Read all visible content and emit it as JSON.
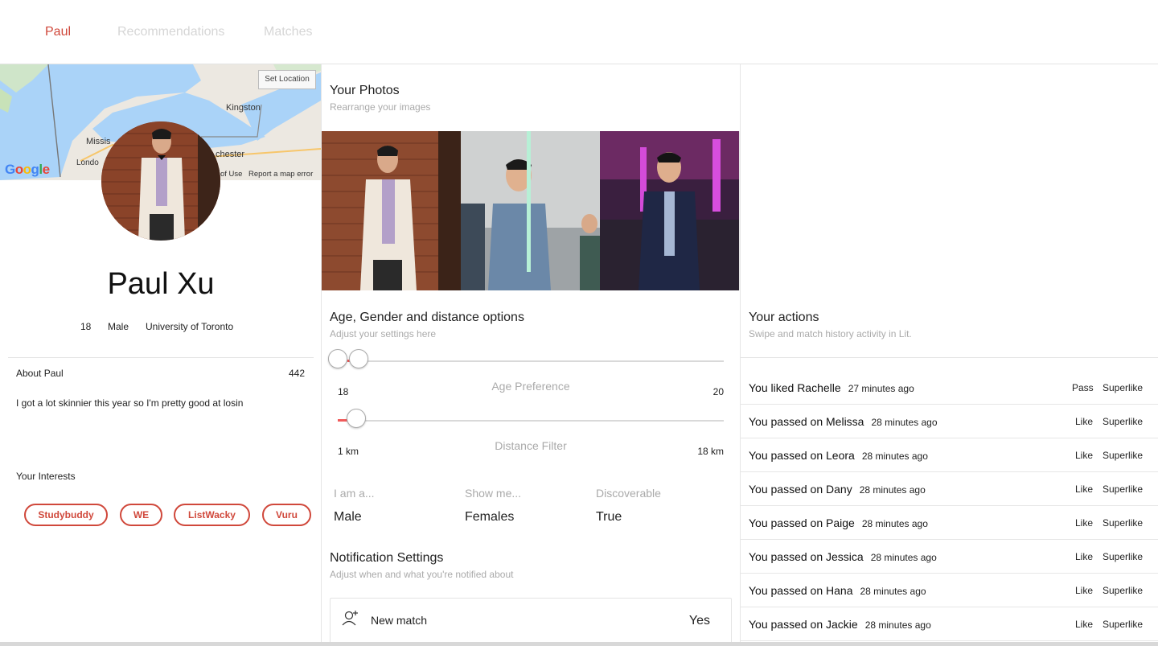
{
  "nav": {
    "tabs": [
      {
        "label": "Paul",
        "active": true
      },
      {
        "label": "Recommendations",
        "active": false
      },
      {
        "label": "Matches",
        "active": false
      }
    ]
  },
  "colors": {
    "accent": "#d0483b",
    "muted": "#aaaaaa",
    "slider": "#f05a5a"
  },
  "map": {
    "set_location_label": "Set Location",
    "labels": [
      "Kingston",
      "Missis",
      "chester",
      "Londo"
    ],
    "google_logo": "Google",
    "footer_terms": "of Use",
    "footer_report": "Report a map error"
  },
  "profile": {
    "name": "Paul Xu",
    "age": "18",
    "gender": "Male",
    "school": "University of Toronto",
    "about_title": "About Paul",
    "about_count": "442",
    "about_text": "I got a lot skinnier this year so I'm pretty good at losin",
    "interests_title": "Your Interests",
    "interests": [
      "Studybuddy",
      "WE",
      "ListWacky",
      "Vuru"
    ]
  },
  "photos": {
    "title": "Your Photos",
    "subtitle": "Rearrange your images"
  },
  "settings": {
    "title": "Age, Gender and distance options",
    "subtitle": "Adjust your settings here",
    "age_label": "Age Preference",
    "age_min": "18",
    "age_max": "20",
    "distance_label": "Distance Filter",
    "distance_min": "1 km",
    "distance_max": "18 km",
    "options": [
      {
        "label": "I am a...",
        "value": "Male"
      },
      {
        "label": "Show me...",
        "value": "Females"
      },
      {
        "label": "Discoverable",
        "value": "True"
      }
    ]
  },
  "notifications": {
    "title": "Notification Settings",
    "subtitle": "Adjust when and what you're notified about",
    "items": [
      {
        "label": "New match",
        "value": "Yes"
      }
    ]
  },
  "actions": {
    "title": "Your actions",
    "subtitle": "Swipe and match history activity in Lit.",
    "rows": [
      {
        "text": "You liked Rachelle",
        "time": "27 minutes ago",
        "btn1": "Pass",
        "btn2": "Superlike"
      },
      {
        "text": "You passed on Melissa",
        "time": "28 minutes ago",
        "btn1": "Like",
        "btn2": "Superlike"
      },
      {
        "text": "You passed on Leora",
        "time": "28 minutes ago",
        "btn1": "Like",
        "btn2": "Superlike"
      },
      {
        "text": "You passed on Dany",
        "time": "28 minutes ago",
        "btn1": "Like",
        "btn2": "Superlike"
      },
      {
        "text": "You passed on Paige",
        "time": "28 minutes ago",
        "btn1": "Like",
        "btn2": "Superlike"
      },
      {
        "text": "You passed on Jessica",
        "time": "28 minutes ago",
        "btn1": "Like",
        "btn2": "Superlike"
      },
      {
        "text": "You passed on Hana",
        "time": "28 minutes ago",
        "btn1": "Like",
        "btn2": "Superlike"
      },
      {
        "text": "You passed on Jackie",
        "time": "28 minutes ago",
        "btn1": "Like",
        "btn2": "Superlike"
      }
    ]
  }
}
